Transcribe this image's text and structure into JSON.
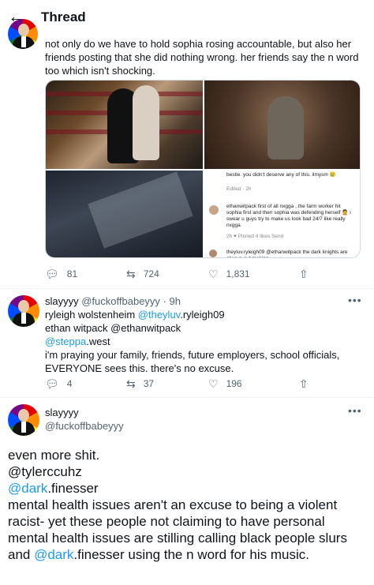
{
  "header": {
    "back_icon": "arrow-left-icon",
    "title": "Thread"
  },
  "tweet1": {
    "text": "not only do we have to hold sophia rosing accountable, but also her friends posting that she did nothing wrong. her friends say the n word too which isn't shocking.",
    "media": {
      "screenshot_lines": [
        "bestie. you didn't deserve any of this. ilmysm 😢",
        "Edited · 2h",
        "ethanwitpack first of all nxgga , the farm worker hit sophia first and then sophia was defending herself 🤦 i swear u guys try to make us look bad 24/7 like really nxgga",
        "2h   ♥ Pinned   4 likes   Send",
        "theyluv.ryleigh09 @ethanwitpack the dark knights are always out making"
      ]
    },
    "actions": {
      "replies": "81",
      "retweets": "724",
      "likes": "1,831"
    }
  },
  "tweet2": {
    "display_name": "slayyyy",
    "handle_time": "@fuckoffbabeyyy · 9h",
    "line1_prefix": "ryleigh wolstenheim ",
    "line1_mention": "@theyluv",
    "line1_suffix": ".ryleigh09",
    "line2": "ethan witpack @ethanwitpack",
    "line3_mention": "@steppa",
    "line3_suffix": ".west",
    "body": "i'm praying your family, friends, future employers, school officials, EVERYONE sees this. there's no excuse.",
    "actions": {
      "replies": "4",
      "retweets": "37",
      "likes": "196"
    }
  },
  "tweet3": {
    "display_name": "slayyyy",
    "handle": "@fuckoffbabeyyy",
    "line1": "even more shit.",
    "line2": "@tylerccuhz",
    "line3_mention": "@dark",
    "line3_suffix": ".finesser",
    "body_a": "mental health issues aren't an excuse to being a violent racist- yet these people not claiming to have personal mental health issues are stilling calling black people slurs and ",
    "body_mention": "@dark",
    "body_b": ".finesser using the n word for his music."
  },
  "colors": {
    "link": "#1d9bf0",
    "muted": "#536471",
    "text": "#0f1419"
  }
}
